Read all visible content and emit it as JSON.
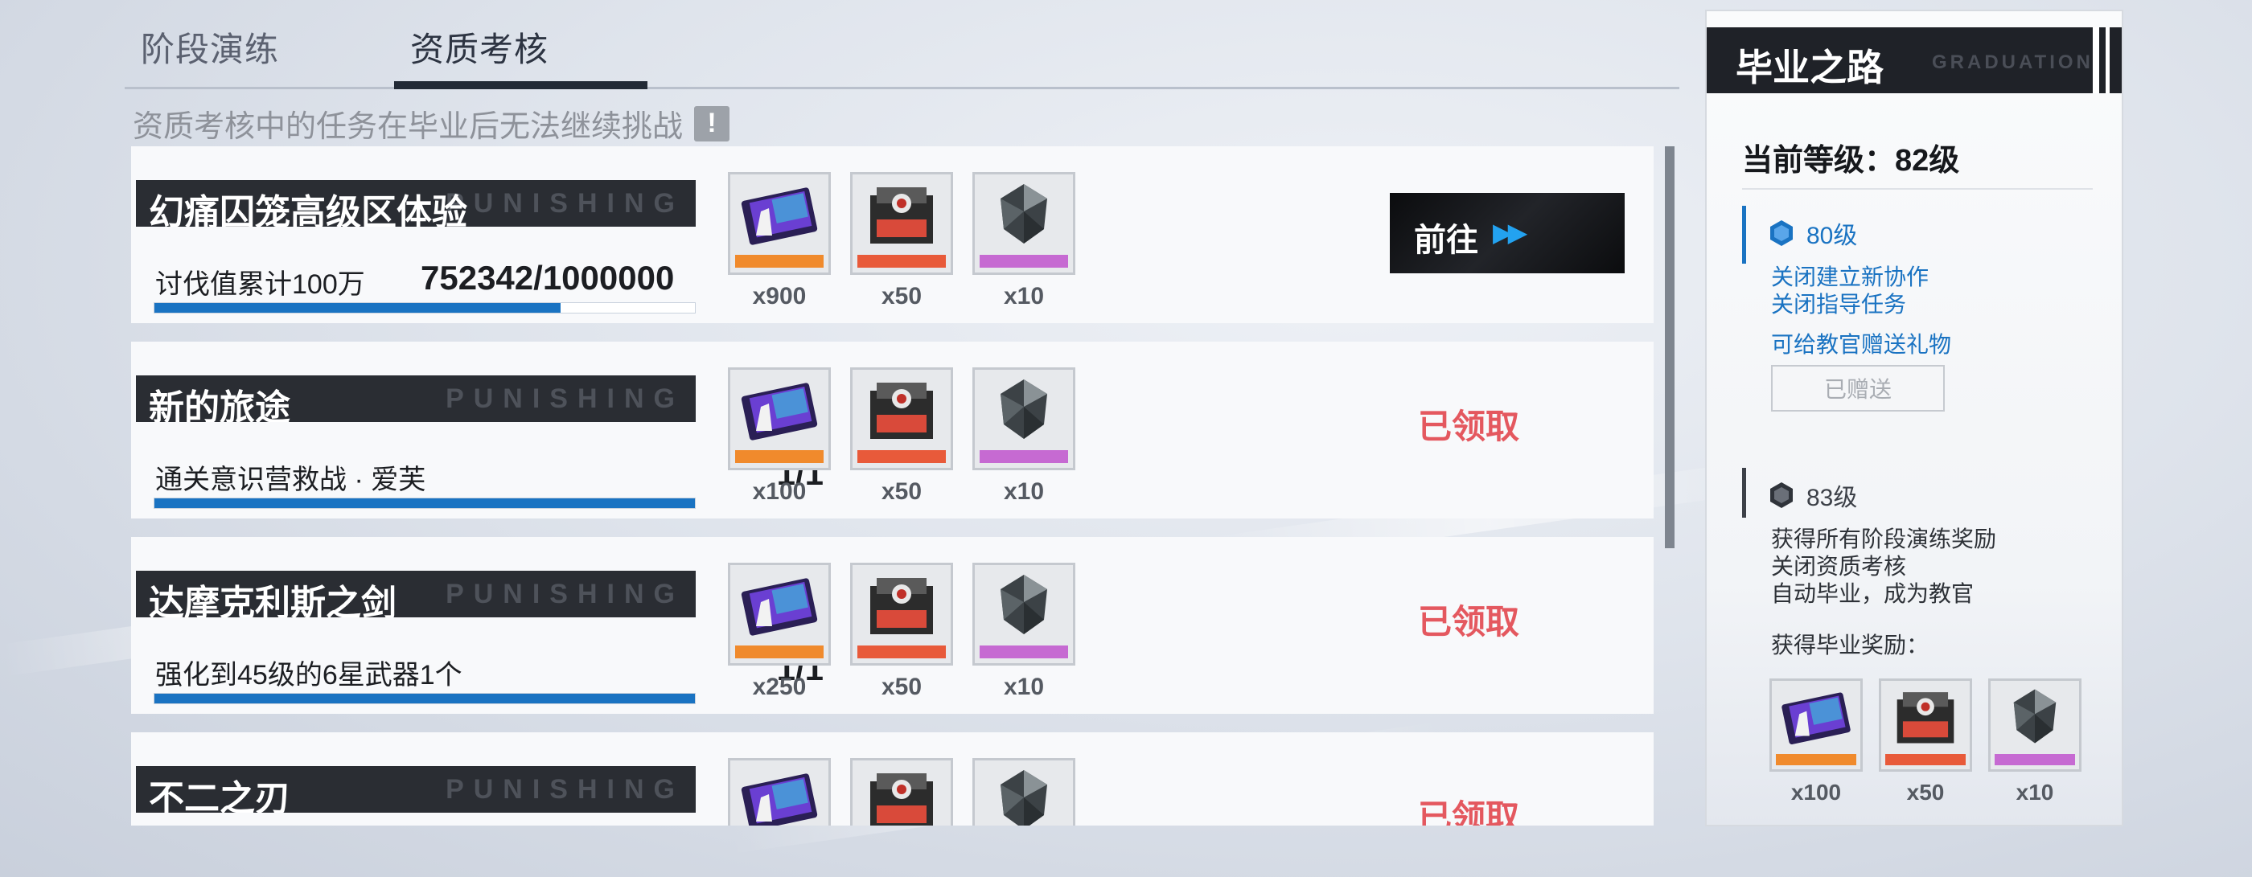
{
  "tabs": [
    {
      "label": "阶段演练"
    },
    {
      "label": "资质考核"
    }
  ],
  "notice": {
    "text": "资质考核中的任务在毕业后无法继续挑战",
    "icon": "exclamation-icon"
  },
  "watermark": "PUNISHING",
  "tasks": [
    {
      "title": "幻痛囚笼高级区体验",
      "description": "讨伐值累计100万",
      "progress_text": "752342/1000000",
      "progress": 0.752,
      "rewards": [
        {
          "icon": "supply-ticket-icon",
          "qty": "x900"
        },
        {
          "icon": "supply-crate-icon",
          "qty": "x50"
        },
        {
          "icon": "supply-crystal-icon",
          "qty": "x10"
        }
      ],
      "action": "前往",
      "action_icon": "fast-forward-icon"
    },
    {
      "title": "新的旅途",
      "description": "通关意识营救战 · 爱芙",
      "progress_text": "1/1",
      "progress": 1,
      "rewards": [
        {
          "icon": "supply-ticket-icon",
          "qty": "x100"
        },
        {
          "icon": "supply-crate-icon",
          "qty": "x50"
        },
        {
          "icon": "supply-crystal-icon",
          "qty": "x10"
        }
      ],
      "status": "已领取"
    },
    {
      "title": "达摩克利斯之剑",
      "description": "强化到45级的6星武器1个",
      "progress_text": "1/1",
      "progress": 1,
      "rewards": [
        {
          "icon": "supply-ticket-icon",
          "qty": "x250"
        },
        {
          "icon": "supply-crate-icon",
          "qty": "x50"
        },
        {
          "icon": "supply-crystal-icon",
          "qty": "x10"
        }
      ],
      "status": "已领取"
    },
    {
      "title": "不二之刃",
      "rewards": [
        {
          "icon": "supply-ticket-icon"
        },
        {
          "icon": "supply-crate-icon"
        },
        {
          "icon": "supply-crystal-icon"
        }
      ],
      "status": "已领取"
    }
  ],
  "graduation": {
    "title": "毕业之路",
    "subtitle": "GRADUATION",
    "current_level": "当前等级：82级",
    "levels": [
      {
        "level": "80级",
        "lines": [
          "关闭建立新协作",
          "关闭指导任务"
        ],
        "gift_text": "可给教官赠送礼物",
        "gift_button": "已赠送",
        "color": "#1a73c2"
      },
      {
        "level": "83级",
        "lines": [
          "获得所有阶段演练奖励",
          "关闭资质考核",
          "自动毕业，成为教官"
        ],
        "rewards_label": "获得毕业奖励：",
        "color": "#3c4048"
      }
    ],
    "rewards": [
      {
        "icon": "supply-ticket-icon",
        "qty": "x100"
      },
      {
        "icon": "supply-crate-icon",
        "qty": "x50"
      },
      {
        "icon": "supply-crystal-icon",
        "qty": "x10"
      }
    ]
  },
  "colors": {
    "accent": "#1a73c2",
    "claimed": "#e4585f",
    "dark": "#2a2d33"
  }
}
